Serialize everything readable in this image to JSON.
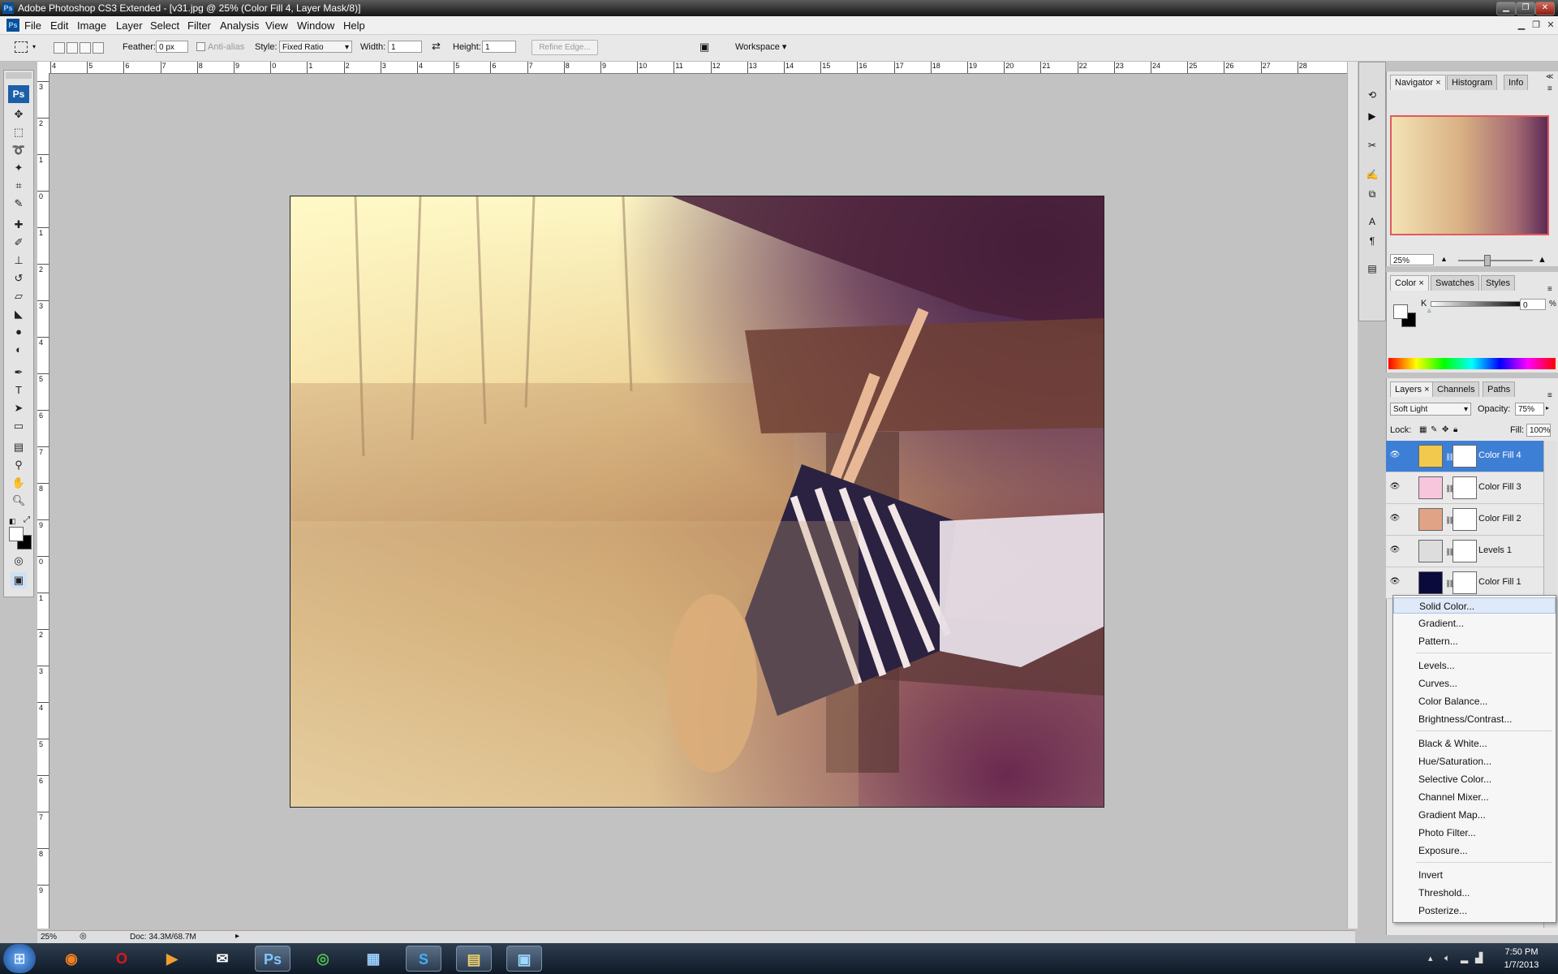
{
  "titlebar": {
    "app_icon": "Ps",
    "title": "Adobe Photoshop CS3 Extended - [v31.jpg @ 25% (Color Fill 4, Layer Mask/8)]"
  },
  "menubar": {
    "items": [
      "File",
      "Edit",
      "Image",
      "Layer",
      "Select",
      "Filter",
      "Analysis",
      "View",
      "Window",
      "Help"
    ]
  },
  "options": {
    "feather_label": "Feather:",
    "feather_value": "0 px",
    "antialias_label": "Anti-alias",
    "style_label": "Style:",
    "style_value": "Fixed Ratio",
    "width_label": "Width:",
    "width_value": "1",
    "height_label": "Height:",
    "height_value": "1",
    "refine_edge_label": "Refine Edge...",
    "workspace_label": "Workspace"
  },
  "ruler": {
    "h_numbers": [
      "4",
      "5",
      "6",
      "7",
      "8",
      "9",
      "0",
      "1",
      "2",
      "3",
      "4",
      "5",
      "6",
      "7",
      "8",
      "9",
      "10",
      "11",
      "12",
      "13",
      "14",
      "15",
      "16",
      "17",
      "18",
      "19",
      "20",
      "21",
      "22",
      "23",
      "24",
      "25",
      "26",
      "27",
      "28"
    ],
    "v_numbers": [
      "3",
      "2",
      "1",
      "0",
      "1",
      "2",
      "3",
      "4",
      "5",
      "6",
      "7",
      "8",
      "9",
      "0",
      "1",
      "2",
      "3",
      "4",
      "5",
      "6",
      "7",
      "8",
      "9"
    ]
  },
  "toolbox": {
    "logo": "Ps"
  },
  "navigator": {
    "tabs": [
      "Navigator",
      "Histogram",
      "Info"
    ],
    "zoom": "25%"
  },
  "color_panel": {
    "tabs": [
      "Color",
      "Swatches",
      "Styles"
    ],
    "channel_label": "K",
    "channel_value": "0",
    "unit": "%"
  },
  "layers_panel": {
    "tabs": [
      "Layers",
      "Channels",
      "Paths"
    ],
    "blend_mode": "Soft Light",
    "opacity_label": "Opacity:",
    "opacity_value": "75%",
    "lock_label": "Lock:",
    "fill_label": "Fill:",
    "fill_value": "100%",
    "layers": [
      {
        "name": "Color Fill 4",
        "color": "#f2c94c",
        "selected": true
      },
      {
        "name": "Color Fill 3",
        "color": "#f7c6dd",
        "selected": false
      },
      {
        "name": "Color Fill 2",
        "color": "#e0a385",
        "selected": false
      },
      {
        "name": "Levels 1",
        "color": "#dddddd",
        "selected": false
      },
      {
        "name": "Color Fill 1",
        "color": "#0a0a3c",
        "selected": false
      }
    ]
  },
  "context_menu": {
    "groups": [
      [
        "Solid Color...",
        "Gradient...",
        "Pattern..."
      ],
      [
        "Levels...",
        "Curves...",
        "Color Balance...",
        "Brightness/Contrast..."
      ],
      [
        "Black & White...",
        "Hue/Saturation...",
        "Selective Color...",
        "Channel Mixer...",
        "Gradient Map...",
        "Photo Filter...",
        "Exposure..."
      ],
      [
        "Invert",
        "Threshold...",
        "Posterize..."
      ]
    ]
  },
  "status": {
    "zoom": "25%",
    "doc": "Doc: 34.3M/68.7M"
  },
  "taskbar": {
    "clock_time": "7:50 PM",
    "clock_date": "1/7/2013",
    "apps": [
      "start",
      "firefox",
      "opera",
      "media",
      "talk",
      "photoshop",
      "chrome",
      "control-panel",
      "skype",
      "explorer",
      "picture"
    ]
  }
}
